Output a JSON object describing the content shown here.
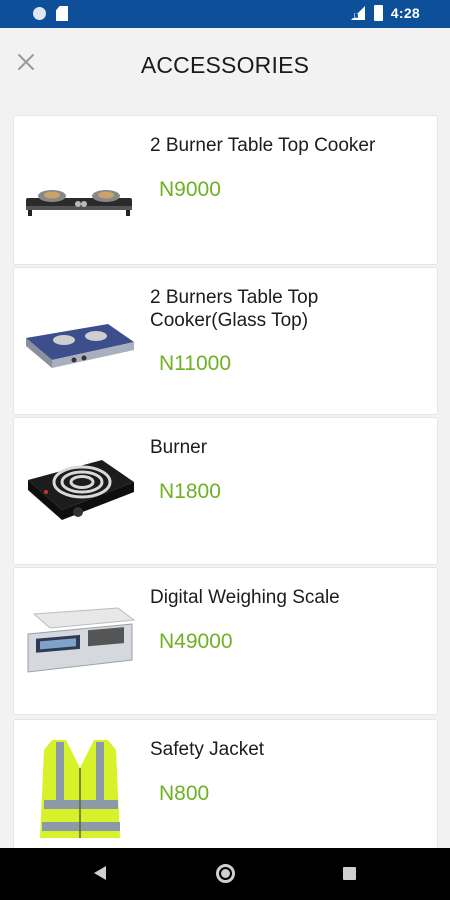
{
  "status_bar": {
    "time": "4:28",
    "icons": [
      "notification-dot-icon",
      "sd-card-icon",
      "signal-icon",
      "battery-icon"
    ]
  },
  "header": {
    "title": "ACCESSORIES",
    "close_icon": "close-icon"
  },
  "products": [
    {
      "name": "2 Burner Table Top Cooker",
      "price": "N9000",
      "image": "gas-cooker-image"
    },
    {
      "name": "2 Burners Table Top Cooker(Glass Top)",
      "price": "N11000",
      "image": "glass-top-cooker-image"
    },
    {
      "name": "Burner",
      "price": "N1800",
      "image": "electric-burner-image"
    },
    {
      "name": "Digital Weighing Scale",
      "price": "N49000",
      "image": "weighing-scale-image"
    },
    {
      "name": "Safety Jacket",
      "price": "N800",
      "image": "safety-jacket-image"
    }
  ],
  "colors": {
    "status_bar": "#0d4f99",
    "price": "#6fb024",
    "background": "#f2f2f2"
  },
  "nav_bar": {
    "icons": [
      "back-icon",
      "home-icon",
      "recents-icon"
    ]
  }
}
